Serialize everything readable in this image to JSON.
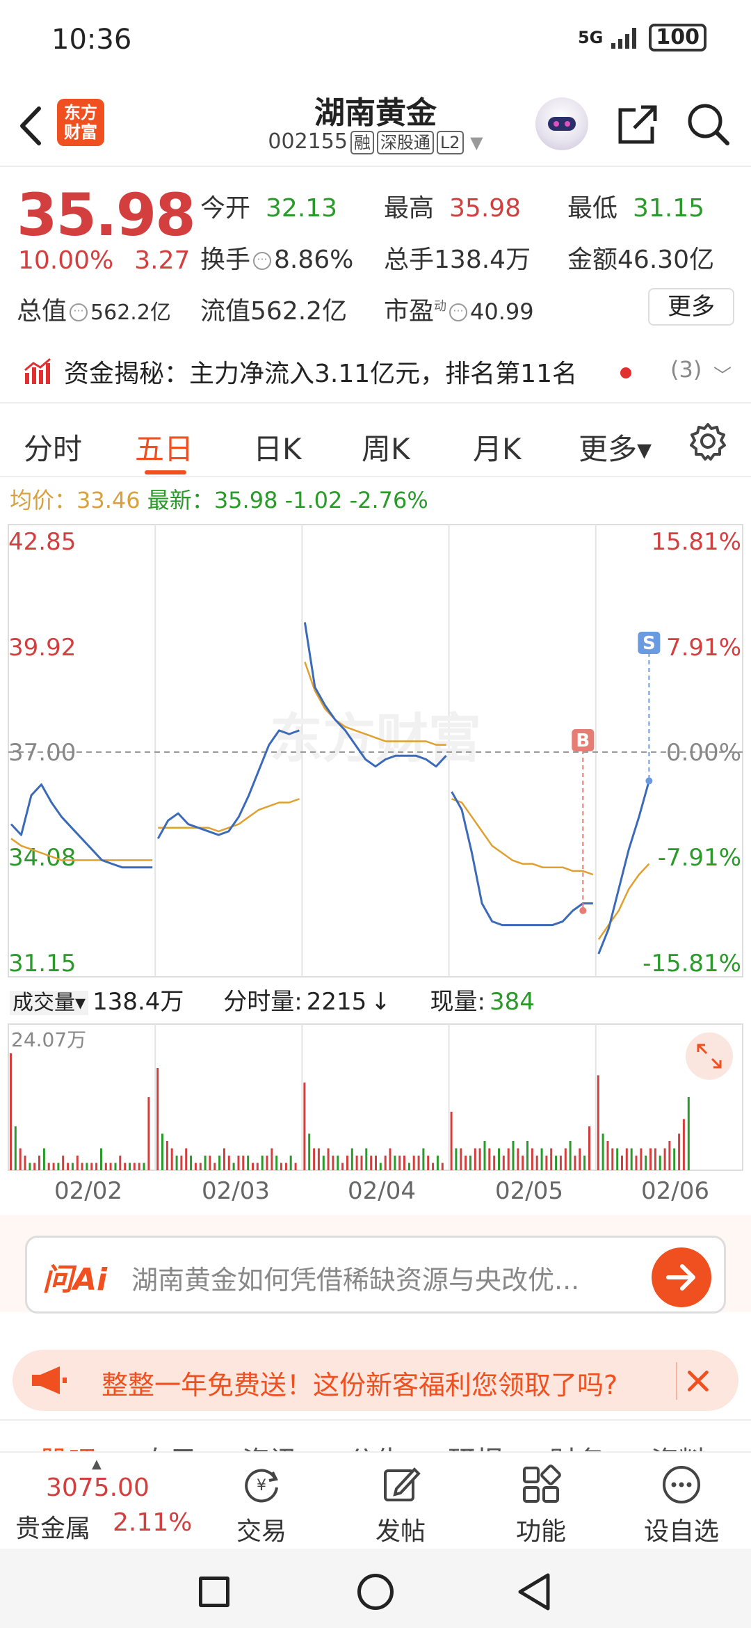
{
  "status": {
    "time": "10:36",
    "network": "5G",
    "battery": "100"
  },
  "header": {
    "logo_line1": "东方",
    "logo_line2": "财富",
    "name": "湖南黄金",
    "code": "002155",
    "badges": [
      "融",
      "深股通",
      "L2"
    ]
  },
  "quote": {
    "price": "35.98",
    "change_pct": "10.00%",
    "change": "3.27",
    "open_label": "今开",
    "open": "32.13",
    "high_label": "最高",
    "high": "35.98",
    "low_label": "最低",
    "low": "31.15",
    "turnover_label": "换手",
    "turnover": "8.86%",
    "volume_label": "总手",
    "volume": "138.4万",
    "amount_label": "金额",
    "amount": "46.30亿",
    "mktcap_label": "总值",
    "mktcap": "562.2亿",
    "float_label": "流值",
    "float": "562.2亿",
    "pe_label": "市盈",
    "pe_sup": "动",
    "pe": "40.99",
    "more_button": "更多"
  },
  "capital": {
    "label": "资金揭秘：",
    "text": "主力净流入3.11亿元，排名第11名",
    "count": "(3)"
  },
  "tabs": {
    "items": [
      "分时",
      "五日",
      "日K",
      "周K",
      "月K",
      "更多▾"
    ],
    "active": "五日"
  },
  "avg_line": {
    "avg_label": "均价：",
    "avg": "33.46",
    "latest_label": "最新：",
    "latest": "35.98",
    "delta": "-1.02",
    "delta_pct": "-2.76%"
  },
  "chart_data": {
    "type": "line",
    "title": "",
    "x": [
      "02/02",
      "02/03",
      "02/04",
      "02/05",
      "02/06"
    ],
    "y_left_ticks": [
      "42.85",
      "39.92",
      "37.00",
      "34.08",
      "31.15"
    ],
    "y_right_ticks": [
      "15.81%",
      "7.91%",
      "0.00%",
      "-7.91%",
      "-15.81%"
    ],
    "ylim": [
      31.15,
      42.85
    ],
    "baseline": 37.0,
    "watermark": "东方财富",
    "series": [
      {
        "name": "",
        "color": "#3a6ab8",
        "values": [
          [
            35.0,
            34.7,
            35.8,
            36.1,
            35.6,
            35.2,
            34.9,
            34.6,
            34.3,
            34.0,
            33.9,
            33.8,
            33.8,
            33.8,
            33.8
          ],
          [
            34.6,
            35.1,
            35.3,
            35.0,
            34.9,
            34.8,
            34.7,
            34.8,
            35.2,
            35.8,
            36.5,
            37.2,
            37.6,
            37.5,
            37.6
          ],
          [
            40.6,
            38.8,
            38.3,
            37.9,
            37.6,
            37.2,
            36.8,
            36.6,
            36.8,
            36.9,
            36.9,
            36.9,
            36.8,
            36.6,
            36.9
          ],
          [
            35.9,
            35.4,
            34.2,
            32.8,
            32.3,
            32.2,
            32.2,
            32.2,
            32.2,
            32.2,
            32.2,
            32.3,
            32.6,
            32.8,
            32.8
          ],
          [
            31.4,
            32.1,
            33.2,
            34.3,
            35.2,
            36.2
          ]
        ]
      },
      {
        "name": "",
        "color": "#e0a030",
        "values": [
          [
            34.6,
            34.4,
            34.3,
            34.2,
            34.1,
            34.0,
            34.0,
            34.0,
            34.0,
            34.0,
            34.0,
            34.0,
            34.0,
            34.0,
            34.0
          ],
          [
            34.9,
            34.9,
            34.9,
            34.9,
            34.9,
            34.9,
            34.8,
            34.9,
            35.0,
            35.2,
            35.4,
            35.5,
            35.6,
            35.6,
            35.7
          ],
          [
            39.5,
            38.7,
            38.2,
            37.9,
            37.7,
            37.6,
            37.5,
            37.4,
            37.3,
            37.3,
            37.3,
            37.3,
            37.3,
            37.2,
            37.2
          ],
          [
            35.7,
            35.6,
            35.2,
            34.8,
            34.4,
            34.2,
            34.0,
            33.9,
            33.9,
            33.8,
            33.8,
            33.8,
            33.7,
            33.7,
            33.6
          ],
          [
            31.8,
            32.2,
            32.6,
            33.2,
            33.6,
            33.9
          ]
        ]
      }
    ],
    "markers": [
      {
        "label": "B",
        "color": "#e67c73",
        "day": 3,
        "index": 13,
        "value": 32.6
      },
      {
        "label": "S",
        "color": "#6a9ae0",
        "day": 4,
        "index": 5,
        "value": 36.2
      }
    ]
  },
  "vol_info": {
    "label": "成交量▾",
    "total": "138.4万",
    "tick_label": "分时量:",
    "tick": "2215",
    "now_label": "现量:",
    "now": "384"
  },
  "volume_chart": {
    "type": "bar",
    "ymax_label": "24.07万",
    "days": [
      [
        16,
        6,
        3,
        2,
        1,
        1,
        2,
        3,
        1,
        1,
        1,
        2,
        1,
        1,
        2,
        1,
        1,
        1,
        1,
        3,
        1,
        1,
        1,
        2,
        1,
        1,
        1,
        1,
        1,
        10
      ],
      [
        14,
        5,
        4,
        3,
        2,
        2,
        3,
        2,
        1,
        1,
        2,
        2,
        1,
        2,
        3,
        2,
        1,
        2,
        2,
        2,
        1,
        1,
        2,
        2,
        3,
        2,
        1,
        1,
        2,
        1
      ],
      [
        12,
        5,
        3,
        3,
        2,
        3,
        2,
        2,
        1,
        2,
        3,
        2,
        2,
        3,
        2,
        2,
        1,
        2,
        3,
        2,
        2,
        2,
        1,
        2,
        2,
        3,
        2,
        1,
        2,
        1
      ],
      [
        8,
        3,
        3,
        2,
        2,
        3,
        3,
        4,
        3,
        2,
        3,
        2,
        3,
        4,
        3,
        2,
        4,
        3,
        2,
        3,
        2,
        3,
        2,
        2,
        3,
        4,
        2,
        3,
        2,
        6
      ],
      [
        13,
        5,
        4,
        3,
        3,
        2,
        3,
        3,
        2,
        3,
        2,
        3,
        3,
        2,
        3,
        4,
        3,
        5,
        7,
        10
      ]
    ]
  },
  "ask": {
    "logo": "问Ai",
    "text": "湖南黄金如何凭借稀缺资源与央改优..."
  },
  "promo": {
    "text": "整整一年免费送！这份新客福利您领取了吗?"
  },
  "subtabs": [
    "股吧",
    "自己",
    "资讯",
    "公告",
    "研报",
    "财务",
    "资料"
  ],
  "toolbar": {
    "index_value": "3075.00",
    "index_name": "贵金属",
    "index_pct": "2.11%",
    "items": [
      "交易",
      "发帖",
      "功能",
      "设自选"
    ]
  }
}
